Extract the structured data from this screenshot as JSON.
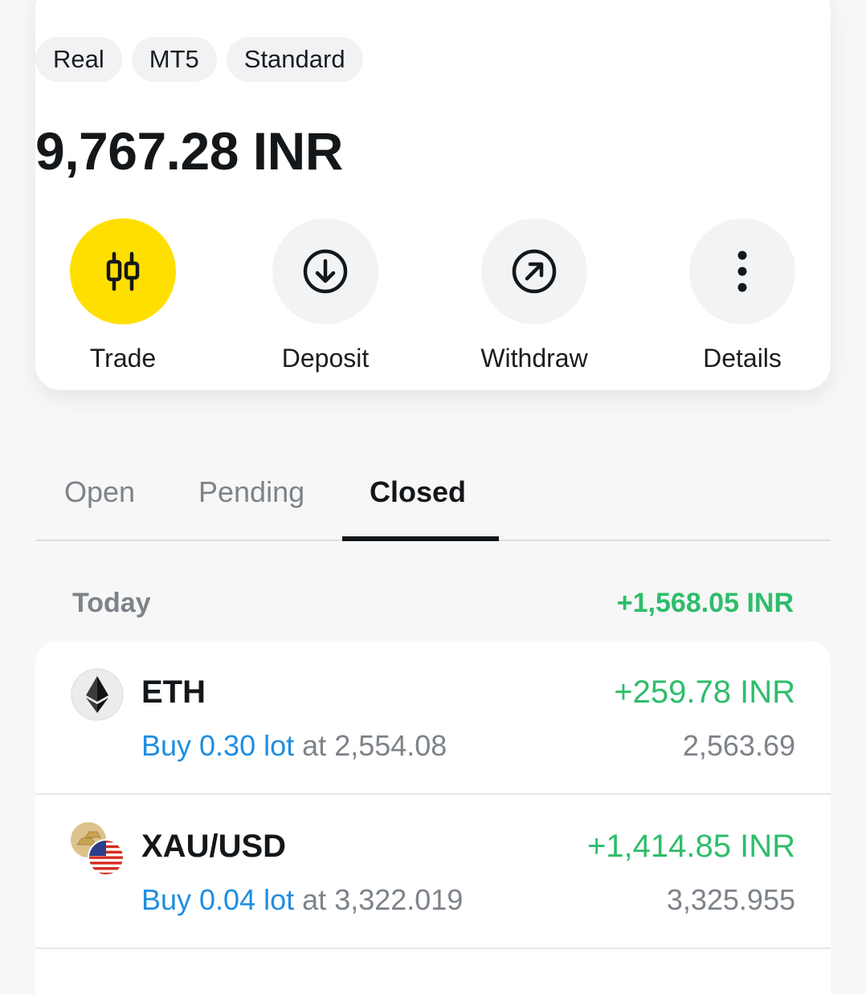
{
  "account": {
    "tags": [
      "Real",
      "MT5",
      "Standard"
    ],
    "balance": "9,767.28 INR"
  },
  "actions": [
    {
      "label": "Trade",
      "icon": "candlestick-icon"
    },
    {
      "label": "Deposit",
      "icon": "arrow-down-circle-icon"
    },
    {
      "label": "Withdraw",
      "icon": "arrow-up-right-circle-icon"
    },
    {
      "label": "Details",
      "icon": "more-vertical-icon"
    }
  ],
  "tabs": [
    "Open",
    "Pending",
    "Closed"
  ],
  "active_tab": "Closed",
  "section": {
    "label": "Today",
    "total": "+1,568.05 INR"
  },
  "trades": [
    {
      "symbol": "ETH",
      "icon": "ethereum-icon",
      "side_lot": "Buy 0.30 lot",
      "at": "at",
      "open_price": "2,554.08",
      "pnl": "+259.78 INR",
      "close_price": "2,563.69"
    },
    {
      "symbol": "XAU/USD",
      "icon": "gold-usd-icon",
      "side_lot": "Buy 0.04 lot",
      "at": "at",
      "open_price": "3,322.019",
      "pnl": "+1,414.85 INR",
      "close_price": "3,325.955"
    }
  ],
  "colors": {
    "accent": "#ffdf00",
    "profit": "#2ebd6b",
    "buy": "#1f8ee0",
    "muted": "#7d8389"
  }
}
